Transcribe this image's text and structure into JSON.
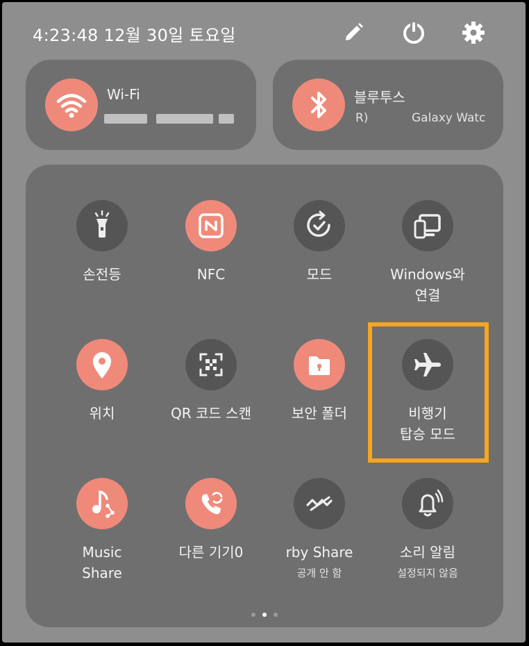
{
  "status": {
    "clock": "4:23:48  12월 30일 토요일",
    "icons": [
      "pencil-icon",
      "power-icon",
      "gear-icon"
    ]
  },
  "wifi": {
    "title": "Wi-Fi",
    "icon": "wifi-icon"
  },
  "bluetooth": {
    "title": "블루투스",
    "sub_left": "R)",
    "sub_right": "Galaxy Watc",
    "icon": "bluetooth-icon"
  },
  "tiles": [
    {
      "label": "손전등",
      "sub": "",
      "state": "off",
      "icon": "flashlight-icon"
    },
    {
      "label": "NFC",
      "sub": "",
      "state": "on",
      "icon": "nfc-icon"
    },
    {
      "label": "모드",
      "sub": "",
      "state": "off",
      "icon": "mode-icon"
    },
    {
      "label": "Windows와\n연결",
      "sub": "",
      "state": "off",
      "icon": "windows-link-icon"
    },
    {
      "label": "위치",
      "sub": "",
      "state": "on",
      "icon": "location-icon"
    },
    {
      "label": "QR 코드 스캔",
      "sub": "",
      "state": "off",
      "icon": "qr-scan-icon"
    },
    {
      "label": "보안 폴더",
      "sub": "",
      "state": "on",
      "icon": "secure-folder-icon"
    },
    {
      "label": "비행기\n탑승 모드",
      "sub": "",
      "state": "off",
      "icon": "airplane-icon"
    },
    {
      "label": "Music\nShare",
      "sub": "",
      "state": "on",
      "icon": "music-share-icon"
    },
    {
      "label": "다른 기기0",
      "sub": "",
      "state": "on",
      "icon": "call-other-device-icon"
    },
    {
      "label": "rby Share",
      "sub": "공개 안 함",
      "state": "off",
      "icon": "nearby-share-icon"
    },
    {
      "label": "소리 알림",
      "sub": "설정되지 않음",
      "state": "off",
      "icon": "sound-alert-icon"
    }
  ],
  "colors": {
    "panel": "#8e8e8e",
    "card": "#6f6f6f",
    "active": "#ef8a7b",
    "inactive": "#555555",
    "highlight": "#f5a623"
  },
  "pager": {
    "pages": 3,
    "current": 2
  }
}
